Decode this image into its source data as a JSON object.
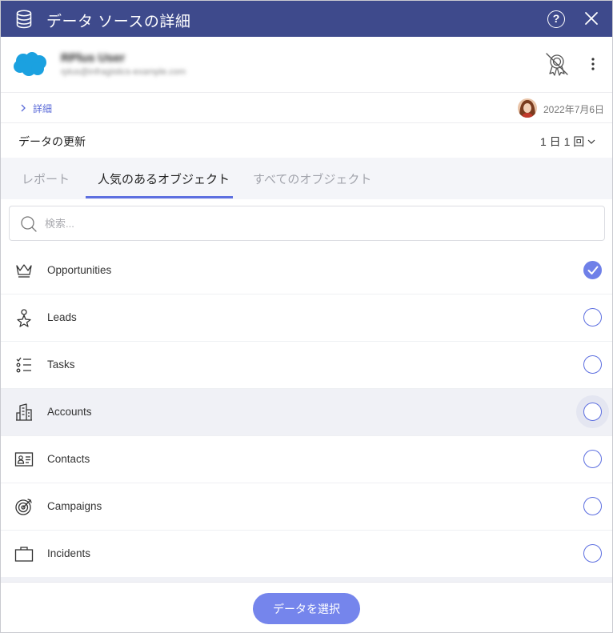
{
  "dialog": {
    "title": "データ ソースの詳細",
    "help_label": "?"
  },
  "account": {
    "name": "RPlus User",
    "email": "rplus@infragistics-example.com"
  },
  "details": {
    "link_label": "詳細",
    "date": "2022年7月6日"
  },
  "refresh": {
    "label": "データの更新",
    "value": "1 日 1 回"
  },
  "tabs": [
    {
      "label": "レポート",
      "active": false
    },
    {
      "label": "人気のあるオブジェクト",
      "active": true
    },
    {
      "label": "すべてのオブジェクト",
      "active": false
    }
  ],
  "search": {
    "placeholder": "検索..."
  },
  "objects": [
    {
      "label": "Opportunities",
      "icon": "crown-icon",
      "selected": true
    },
    {
      "label": "Leads",
      "icon": "person-star-icon",
      "selected": false
    },
    {
      "label": "Tasks",
      "icon": "checklist-icon",
      "selected": false
    },
    {
      "label": "Accounts",
      "icon": "building-icon",
      "selected": false,
      "hovered": true
    },
    {
      "label": "Contacts",
      "icon": "contact-card-icon",
      "selected": false
    },
    {
      "label": "Campaigns",
      "icon": "target-icon",
      "selected": false
    },
    {
      "label": "Incidents",
      "icon": "briefcase-icon",
      "selected": false
    }
  ],
  "footer": {
    "select_button": "データを選択"
  },
  "colors": {
    "titlebar": "#3e4a8c",
    "accent": "#5d6fe0",
    "button": "#7585ec",
    "salesforce": "#1ba1e0"
  }
}
